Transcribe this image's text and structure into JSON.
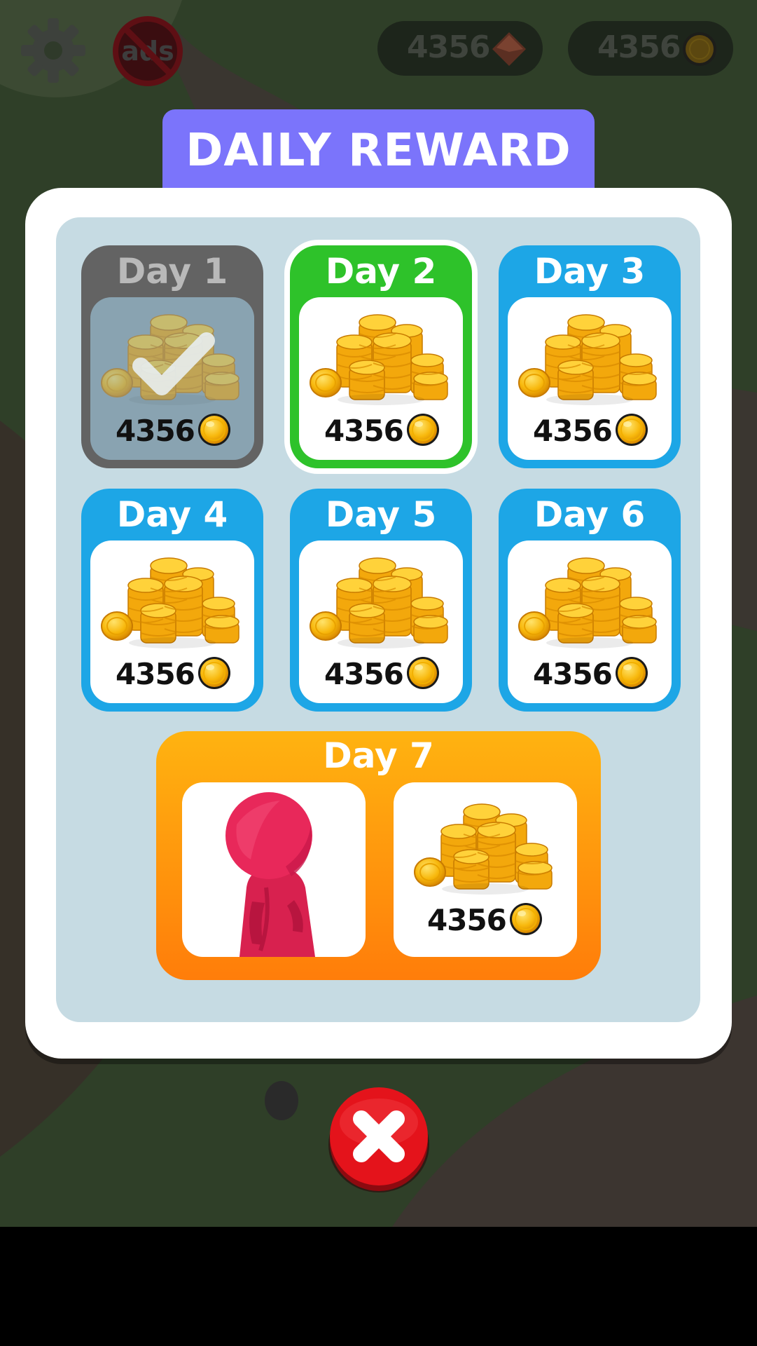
{
  "hud": {
    "gems_count": "4356",
    "coins_count": "4356",
    "settings_icon": "gear-icon",
    "no_ads_icon": "no-ads-icon",
    "no_ads_label": "ads"
  },
  "dialog": {
    "title": "DAILY REWARD",
    "days": [
      {
        "label": "Day 1",
        "amount": "4356",
        "state": "claimed"
      },
      {
        "label": "Day 2",
        "amount": "4356",
        "state": "current"
      },
      {
        "label": "Day 3",
        "amount": "4356",
        "state": "locked"
      },
      {
        "label": "Day 4",
        "amount": "4356",
        "state": "locked"
      },
      {
        "label": "Day 5",
        "amount": "4356",
        "state": "locked"
      },
      {
        "label": "Day 6",
        "amount": "4356",
        "state": "locked"
      }
    ],
    "day7": {
      "label": "Day 7",
      "amount": "4356",
      "bonus_item": "pink-character-skin"
    }
  },
  "colors": {
    "title_banner": "#7b74fb",
    "claimed": "#636363",
    "current": "#2ec22a",
    "locked": "#1da6e6",
    "day7_top": "#ffb310",
    "day7_bottom": "#ff7d0a",
    "close_button": "#e4131b"
  },
  "close_icon": "close-x-icon"
}
